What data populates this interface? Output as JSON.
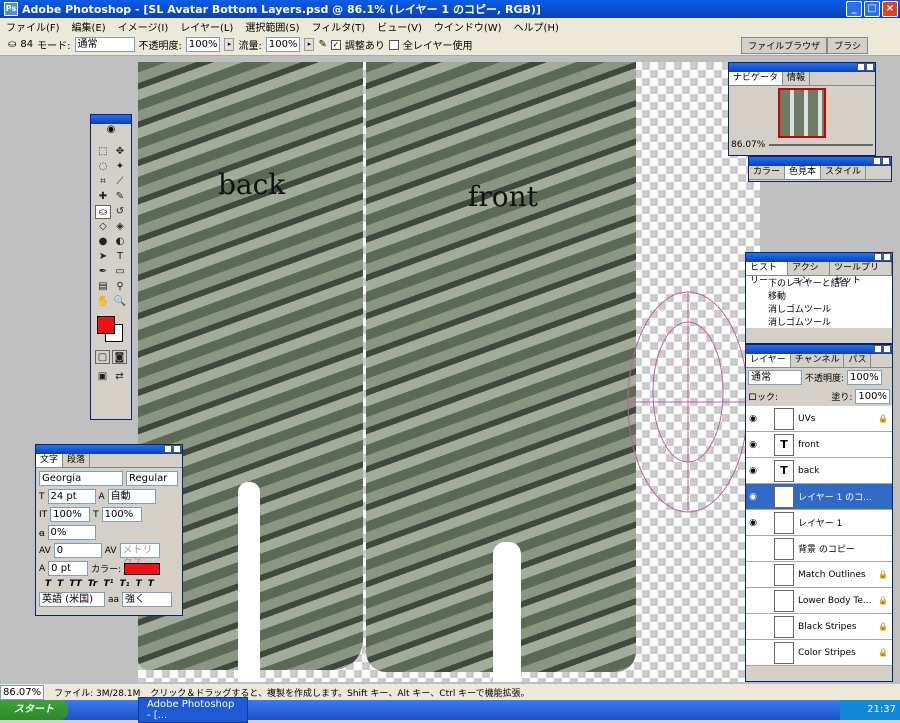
{
  "title": "Adobe Photoshop - [SL Avatar Bottom Layers.psd @ 86.1% (レイヤー 1 のコピー, RGB)]",
  "menu": [
    "ファイル(F)",
    "編集(E)",
    "イメージ(I)",
    "レイヤー(L)",
    "選択範囲(S)",
    "フィルタ(T)",
    "ビュー(V)",
    "ウインドウ(W)",
    "ヘルプ(H)"
  ],
  "options": {
    "brush_size": "84",
    "mode_label": "モード:",
    "mode": "通常",
    "opacity_label": "不透明度:",
    "opacity": "100%",
    "flow_label": "流量:",
    "flow": "100%",
    "aligned_label": "調整あり",
    "all_layers_label": "全レイヤー使用"
  },
  "palette_tabs": [
    "ファイルブラウザ",
    "ブラシ"
  ],
  "canvas": {
    "label_back": "back",
    "label_front": "front"
  },
  "navigator": {
    "tabs": [
      "ナビゲータ",
      "情報"
    ],
    "zoom": "86.07%"
  },
  "color_panel": {
    "tabs": [
      "カラー",
      "色見本",
      "スタイル"
    ]
  },
  "history": {
    "tabs": [
      "ヒストリー",
      "アクション",
      "ツールプリセット"
    ],
    "items": [
      "下のレイヤーと結合",
      "移動",
      "消しゴムツール",
      "消しゴムツール"
    ]
  },
  "layers": {
    "tabs": [
      "レイヤー",
      "チャンネル",
      "パス"
    ],
    "mode": "通常",
    "opacity_label": "不透明度:",
    "opacity": "100%",
    "fill_label": "塗り:",
    "fill": "100%",
    "lock_label": "ロック:",
    "rows": [
      {
        "name": "UVs",
        "thumb": "",
        "visible": "◉",
        "locked": "🔒",
        "selected": false
      },
      {
        "name": "front",
        "thumb": "T",
        "visible": "◉",
        "locked": "",
        "selected": false
      },
      {
        "name": "back",
        "thumb": "T",
        "visible": "◉",
        "locked": "",
        "selected": false
      },
      {
        "name": "レイヤー 1 のコ...",
        "thumb": "",
        "visible": "◉",
        "locked": "",
        "selected": true
      },
      {
        "name": "レイヤー 1",
        "thumb": "",
        "visible": "◉",
        "locked": "",
        "selected": false
      },
      {
        "name": "背景 のコピー",
        "thumb": "",
        "visible": "",
        "locked": "",
        "selected": false
      },
      {
        "name": "Match Outlines",
        "thumb": "",
        "visible": "",
        "locked": "🔒",
        "selected": false
      },
      {
        "name": "Lower Body Te...",
        "thumb": "",
        "visible": "",
        "locked": "🔒",
        "selected": false
      },
      {
        "name": "Black Stripes",
        "thumb": "",
        "visible": "",
        "locked": "🔒",
        "selected": false
      },
      {
        "name": "Color Stripes",
        "thumb": "",
        "visible": "",
        "locked": "🔒",
        "selected": false
      }
    ]
  },
  "character": {
    "tabs": [
      "文字",
      "段落"
    ],
    "font": "Georgia",
    "style": "Regular",
    "size": "24 pt",
    "leading": "自動",
    "vscale": "100%",
    "hscale": "100%",
    "tracking_pct": "0%",
    "kerning": "0",
    "kerning_metric": "メトリクス",
    "baseline": "0 pt",
    "color_label": "カラー:",
    "color": "#ee1111",
    "language": "英語 (米国)",
    "aa_label": "aa",
    "aa": "強く"
  },
  "status": {
    "zoom": "86.07%",
    "file": "ファイル: 3M/28.1M",
    "hint": "クリック＆ドラッグすると、複製を作成します。Shift キー、Alt キー、Ctrl キーで機能拡張。"
  },
  "taskbar": {
    "start": "スタート",
    "task": "Adobe Photoshop - [...",
    "time": "21:37"
  }
}
